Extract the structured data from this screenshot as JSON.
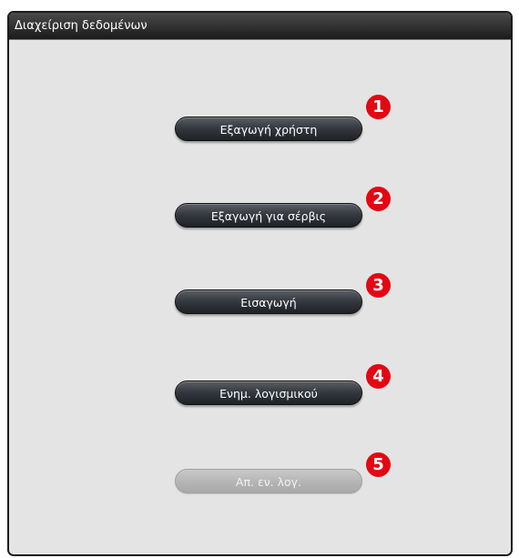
{
  "window": {
    "title": "Διαχείριση δεδομένων"
  },
  "buttons": [
    {
      "label": "Εξαγωγή χρήστη",
      "enabled": true
    },
    {
      "label": "Εξαγωγή για σέρβις",
      "enabled": true
    },
    {
      "label": "Εισαγωγή",
      "enabled": true
    },
    {
      "label": "Ενημ. λογισμικού",
      "enabled": true
    },
    {
      "label": "Απ. εν. λογ.",
      "enabled": false
    }
  ],
  "callouts": [
    "1",
    "2",
    "3",
    "4",
    "5"
  ],
  "colors": {
    "callout": "#e30613",
    "header": "#2a2a2a",
    "button": "#363a40",
    "button_disabled": "#b3b3b3"
  }
}
